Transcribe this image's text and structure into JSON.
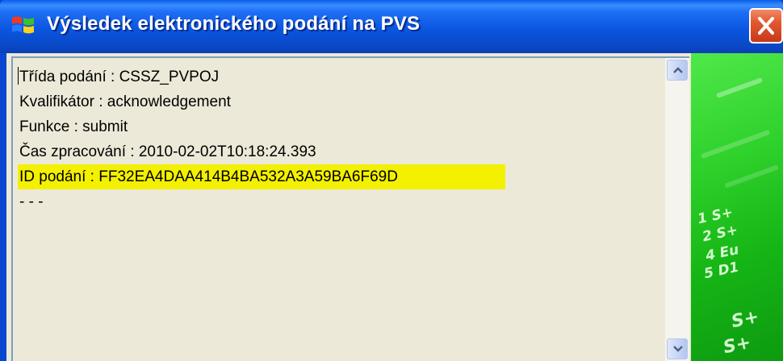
{
  "window": {
    "title": "Výsledek elektronického podání na PVS",
    "icon": "windows-flag-icon",
    "close_icon": "close-icon"
  },
  "result": {
    "lines": [
      "Třída podání : CSSZ_PVPOJ",
      "Kvalifikátor : acknowledgement",
      "Funkce : submit",
      "Čas zpracování : 2010-02-02T10:18:24.393",
      "ID podání : FF32EA4DAA414B4BA532A3A59BA6F69D",
      "- - -"
    ],
    "highlighted_line_index": 4
  },
  "scrollbar": {
    "up_icon": "chevron-up-icon",
    "down_icon": "chevron-down-icon"
  },
  "colors": {
    "titlebar": "#0b56e0",
    "highlight": "#f3f000",
    "close_button": "#e2572f",
    "side_panel": "#2fd12b"
  }
}
